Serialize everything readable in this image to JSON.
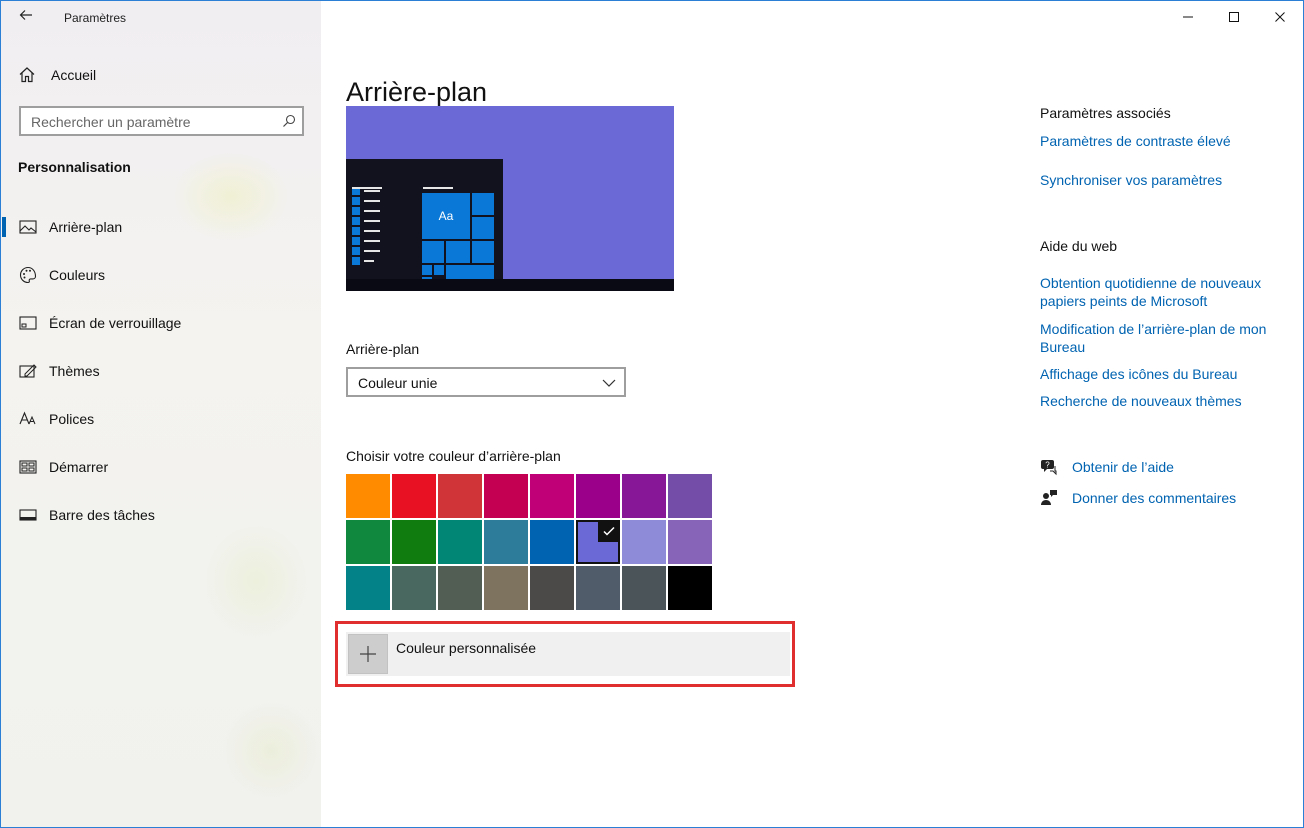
{
  "window": {
    "app_title": "Paramètres"
  },
  "sidebar": {
    "home_label": "Accueil",
    "search_placeholder": "Rechercher un paramètre",
    "section_title": "Personnalisation",
    "items": [
      {
        "label": "Arrière-plan",
        "icon": "picture-icon",
        "active": true
      },
      {
        "label": "Couleurs",
        "icon": "palette-icon",
        "active": false
      },
      {
        "label": "Écran de verrouillage",
        "icon": "lock-screen-icon",
        "active": false
      },
      {
        "label": "Thèmes",
        "icon": "themes-icon",
        "active": false
      },
      {
        "label": "Polices",
        "icon": "fonts-icon",
        "active": false
      },
      {
        "label": "Démarrer",
        "icon": "start-icon",
        "active": false
      },
      {
        "label": "Barre des tâches",
        "icon": "taskbar-icon",
        "active": false
      }
    ]
  },
  "main": {
    "page_title": "Arrière-plan",
    "preview": {
      "background_color": "#6b69d6",
      "tile_text": "Aa"
    },
    "background_label": "Arrière-plan",
    "background_select_value": "Couleur unie",
    "choose_color_label": "Choisir votre couleur d’arrière-plan",
    "colors": [
      [
        "#ff8c00",
        "#e81123",
        "#d13438",
        "#c30052",
        "#bf0077",
        "#9a0089",
        "#881798",
        "#744da9"
      ],
      [
        "#10893e",
        "#107c10",
        "#018574",
        "#2d7d9a",
        "#0063b1",
        "#6b69d6",
        "#8e8cd8",
        "#8764b8"
      ],
      [
        "#038387",
        "#486860",
        "#525e54",
        "#7e735f",
        "#4c4a48",
        "#515c6b",
        "#4a5459",
        "#000000"
      ]
    ],
    "selected_color": "#6b69d6",
    "custom_color_label": "Couleur personnalisée"
  },
  "related": {
    "header": "Paramètres associés",
    "links": [
      "Paramètres de contraste élevé",
      "Synchroniser vos paramètres"
    ]
  },
  "web_help": {
    "header": "Aide du web",
    "links": [
      "Obtention quotidienne de nouveaux papiers peints de Microsoft",
      "Modification de l’arrière-plan de mon Bureau",
      "Affichage des icônes du Bureau",
      "Recherche de nouveaux thèmes"
    ]
  },
  "actions": {
    "get_help": "Obtenir de l’aide",
    "feedback": "Donner des commentaires"
  },
  "colors": {
    "accent": "#0063b1",
    "highlight_border": "#e02e2e"
  }
}
